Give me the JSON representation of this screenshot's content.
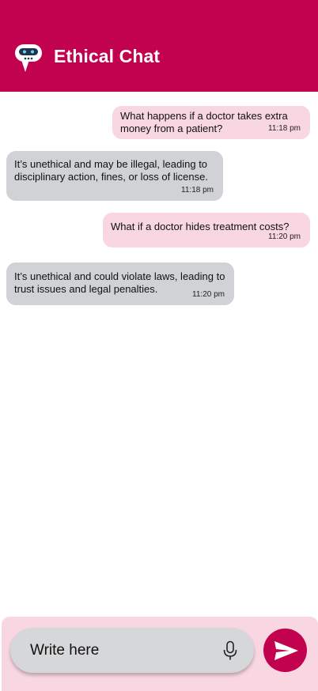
{
  "header": {
    "title": "Ethical Chat",
    "logo_icon": "chat-robot-icon",
    "color": "#c2024e"
  },
  "messages": [
    {
      "role": "user",
      "text": "What happens if a doctor takes extra money from a patient?",
      "time": "11:18 pm"
    },
    {
      "role": "bot",
      "text": "It’s unethical and may be illegal, leading to disciplinary action, fines, or loss of license.",
      "time": "11:18 pm"
    },
    {
      "role": "user",
      "text": "What if a doctor hides treatment costs?",
      "time": "11:20 pm"
    },
    {
      "role": "bot",
      "text": "It’s unethical and could violate laws, leading to trust issues and legal penalties.",
      "time": "11:20 pm"
    }
  ],
  "composer": {
    "placeholder": "Write here",
    "value": "",
    "mic_icon": "microphone-icon",
    "send_icon": "send-icon"
  },
  "colors": {
    "accent": "#c2024e",
    "sent_bubble": "#f8d6e2",
    "received_bubble": "#d0d2d6",
    "composer_bg": "#f8d6e2"
  }
}
